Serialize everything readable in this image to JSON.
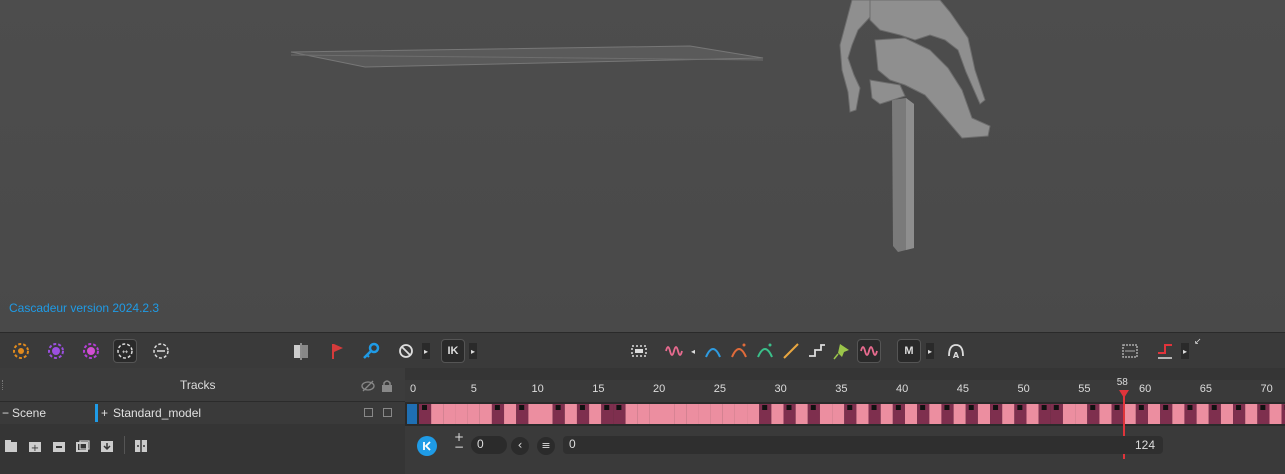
{
  "viewport": {
    "version_text": "Cascadeur version 2024.2.3"
  },
  "toolbar": {
    "ik_label": "IK",
    "m_label": "M",
    "icons": [
      "fulcrum-icon",
      "purple-target-icon",
      "purple-point-icon",
      "autophysics-icon",
      "retarget-icon",
      "camera-frame-icon",
      "red-flag-icon",
      "key-icon",
      "cancel-icon",
      "ik-toggle",
      "selection-frame-icon",
      "wave-icon",
      "bezier-icon",
      "bezier-x-icon",
      "bezier-c-icon",
      "linear-icon",
      "step-icon",
      "pin-icon",
      "wave-active-icon",
      "mode-m-icon",
      "avatar-a-icon",
      "fit-frame-icon",
      "swap-red-icon"
    ]
  },
  "tracks": {
    "title": "Tracks",
    "scene_label": "Scene",
    "scene_toggle": "−",
    "model_toggle": "+",
    "model_label": "Standard_model"
  },
  "timeline": {
    "ticks": [
      "0",
      "5",
      "10",
      "15",
      "20",
      "25",
      "30",
      "35",
      "40",
      "45",
      "50",
      "55",
      "60",
      "65",
      "70"
    ],
    "current_frame": "58",
    "start_field": "0",
    "interval_field": "0",
    "total_frames": "124",
    "colors": {
      "light": "#ec8ea0",
      "dark": "#7e2f4e",
      "accent": "#1f9be6",
      "playhead": "#e0343b"
    }
  }
}
